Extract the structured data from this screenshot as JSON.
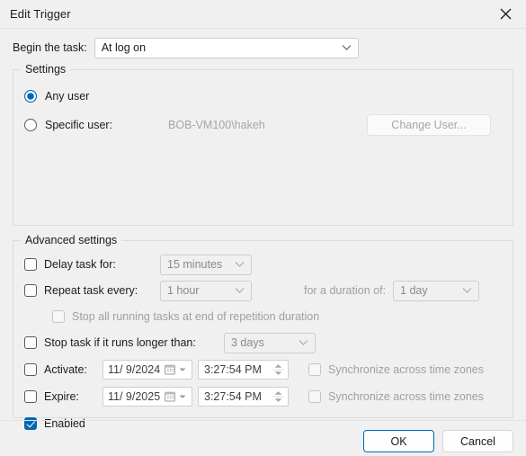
{
  "window": {
    "title": "Edit Trigger",
    "close_icon": "close-icon"
  },
  "begin": {
    "label": "Begin the task:",
    "value": "At log on"
  },
  "settings": {
    "legend": "Settings",
    "any_user": {
      "label": "Any user",
      "checked": true
    },
    "specific_user": {
      "label": "Specific user:",
      "checked": false,
      "value": "BOB-VM100\\hakeh"
    },
    "change_user_button": "Change User..."
  },
  "advanced": {
    "legend": "Advanced settings",
    "delay_task": {
      "label": "Delay task for:",
      "value": "15 minutes",
      "checked": false
    },
    "repeat_task": {
      "label": "Repeat task every:",
      "value": "1 hour",
      "checked": false
    },
    "duration": {
      "label": "for a duration of:",
      "value": "1 day"
    },
    "stop_all_running": {
      "label": "Stop all running tasks at end of repetition duration",
      "checked": false
    },
    "stop_task_longer": {
      "label": "Stop task if it runs longer than:",
      "value": "3 days",
      "checked": false
    },
    "activate": {
      "label": "Activate:",
      "date": "11/ 9/2024",
      "time": "3:27:54 PM",
      "checked": false,
      "sync_label": "Synchronize across time zones",
      "sync_checked": false
    },
    "expire": {
      "label": "Expire:",
      "date": "11/ 9/2025",
      "time": "3:27:54 PM",
      "checked": false,
      "sync_label": "Synchronize across time zones",
      "sync_checked": false
    },
    "enabled": {
      "label": "Enabled",
      "checked": true
    }
  },
  "footer": {
    "ok": "OK",
    "cancel": "Cancel"
  },
  "colors": {
    "accent": "#0066b4",
    "focus_border": "#0067b8",
    "dialog_bg": "#f0f0f0",
    "disabled_text": "#a0a0a0"
  }
}
